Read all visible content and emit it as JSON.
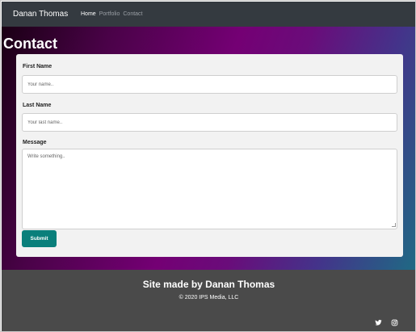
{
  "navbar": {
    "brand": "Danan Thomas",
    "links": [
      "Home",
      "Portfolio",
      "Contact"
    ],
    "active_link": "Home"
  },
  "page": {
    "title": "Contact"
  },
  "form": {
    "first_name": {
      "label": "First Name",
      "placeholder": "Your name..",
      "value": ""
    },
    "last_name": {
      "label": "Last Name",
      "placeholder": "Your last name..",
      "value": ""
    },
    "message": {
      "label": "Message",
      "placeholder": "Write something..",
      "value": ""
    },
    "submit_label": "Submit"
  },
  "footer": {
    "title": "Site made by Danan Thomas",
    "copyright": "© 2020 IPS Media, LLC",
    "social_icons": [
      "twitter-icon",
      "instagram-icon"
    ]
  },
  "colors": {
    "navbar_bg": "#343a40",
    "submit_bg": "#0a7f7b",
    "footer_bg": "#4a4a4a",
    "hero_gradient": [
      "#1a0014",
      "#740074",
      "#1f6a84"
    ]
  }
}
